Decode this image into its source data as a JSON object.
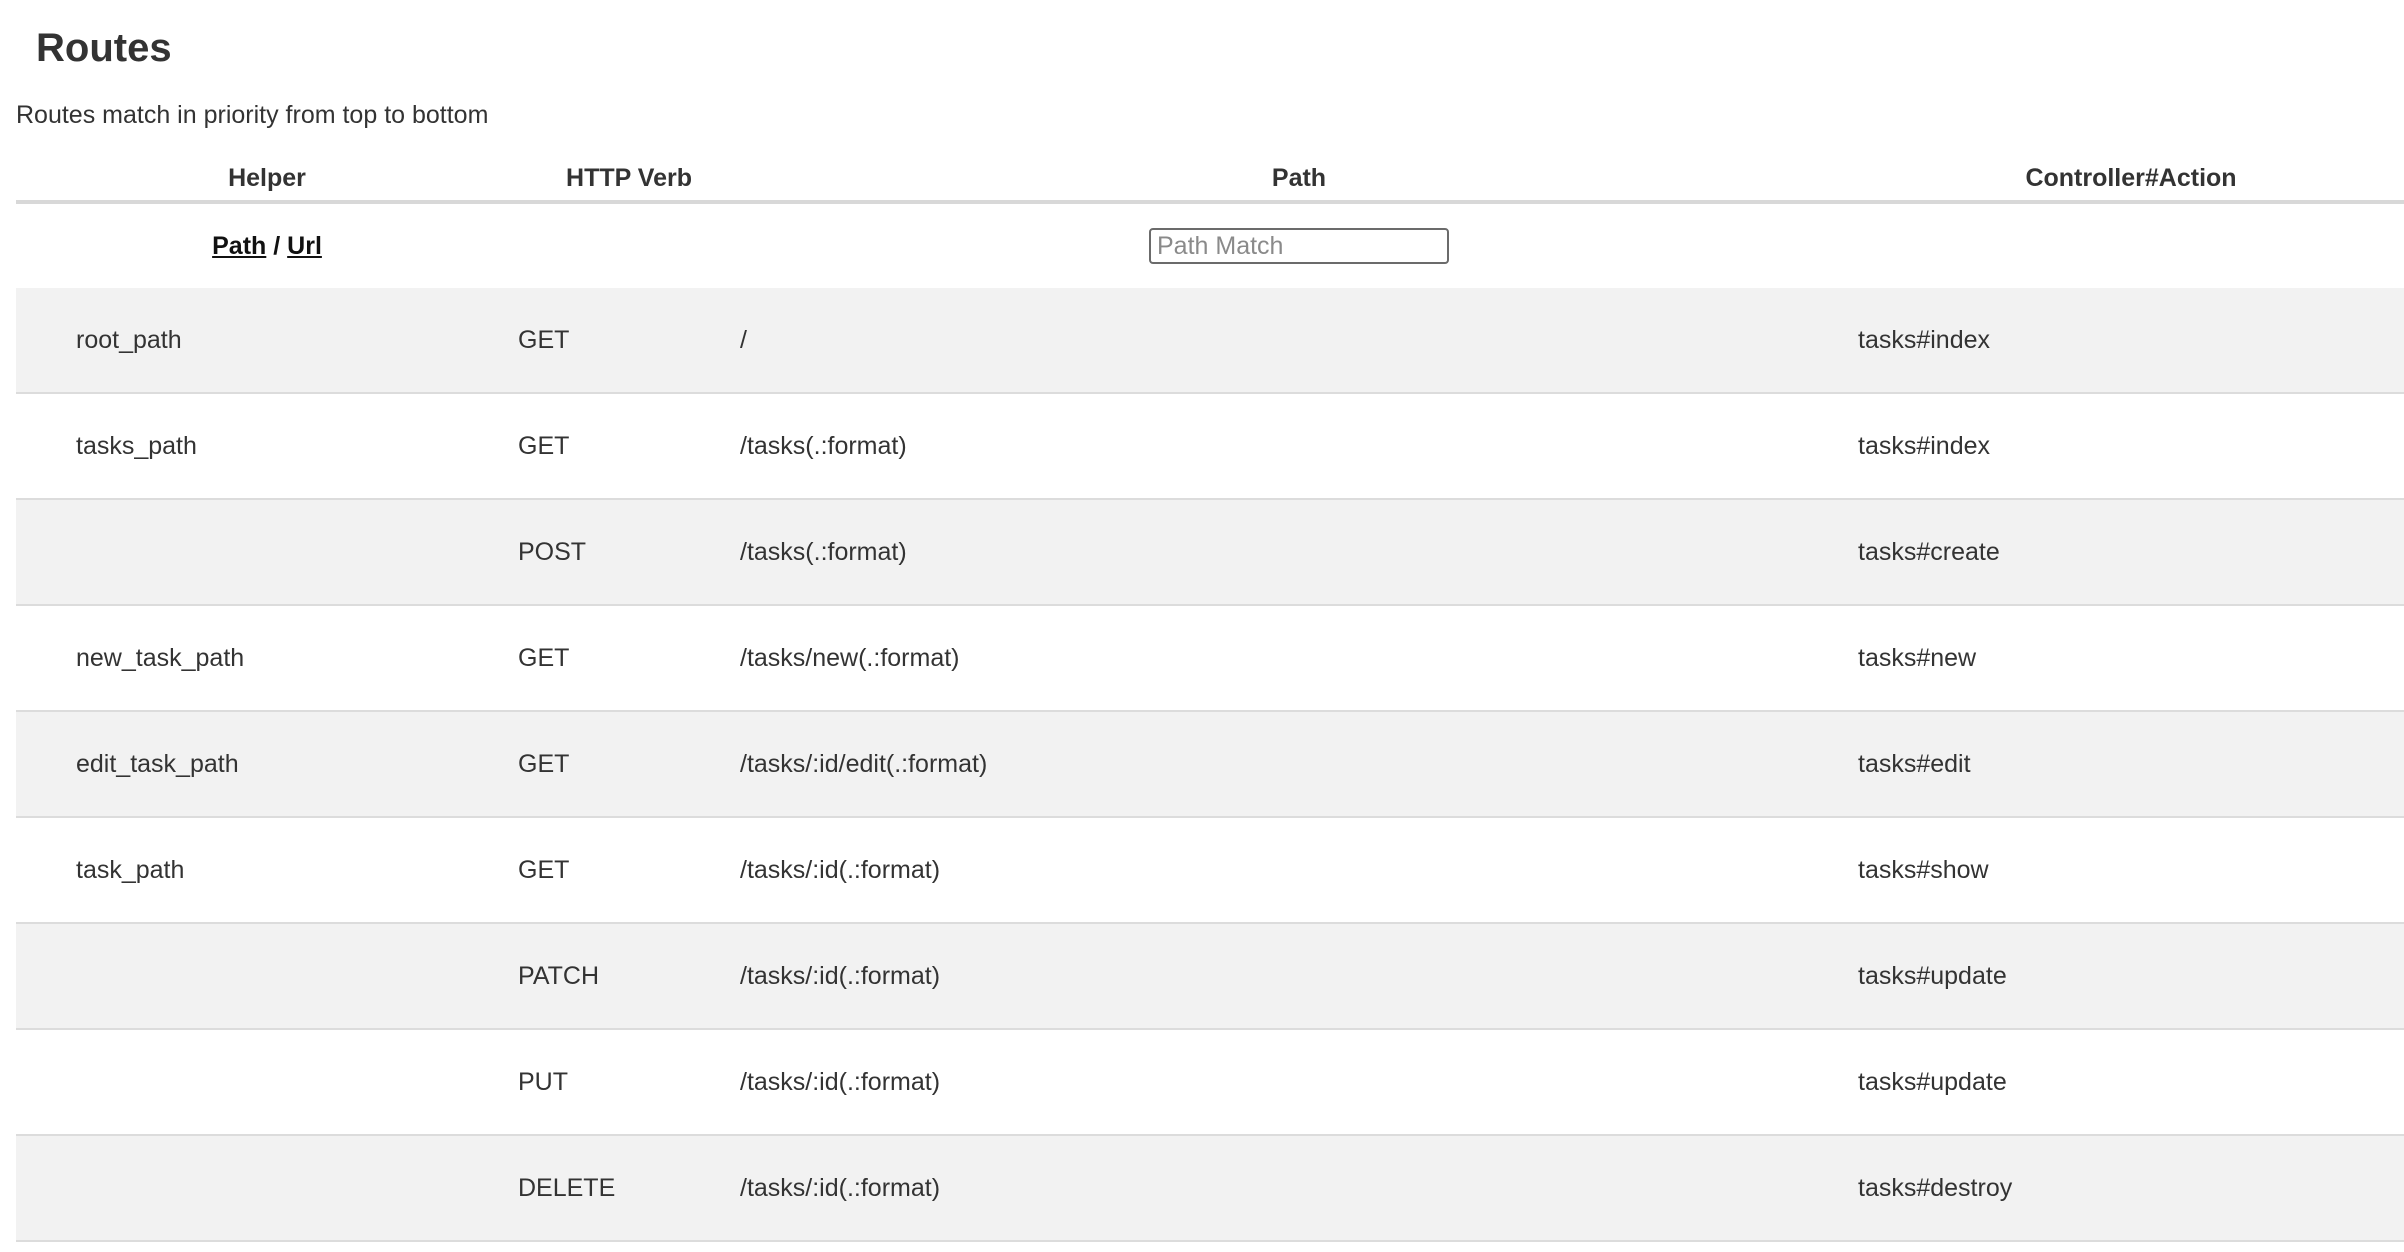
{
  "page": {
    "title": "Routes",
    "subtitle": "Routes match in priority from top to bottom"
  },
  "table": {
    "headers": {
      "helper": "Helper",
      "verb": "HTTP Verb",
      "path": "Path",
      "action": "Controller#Action"
    },
    "filter": {
      "path_link": "Path",
      "separator": "/",
      "url_link": "Url",
      "search_placeholder": "Path Match",
      "search_value": ""
    },
    "rows": [
      {
        "helper": "root_path",
        "verb": "GET",
        "path": "/",
        "action": "tasks#index"
      },
      {
        "helper": "tasks_path",
        "verb": "GET",
        "path": "/tasks(.:format)",
        "action": "tasks#index"
      },
      {
        "helper": "",
        "verb": "POST",
        "path": "/tasks(.:format)",
        "action": "tasks#create"
      },
      {
        "helper": "new_task_path",
        "verb": "GET",
        "path": "/tasks/new(.:format)",
        "action": "tasks#new"
      },
      {
        "helper": "edit_task_path",
        "verb": "GET",
        "path": "/tasks/:id/edit(.:format)",
        "action": "tasks#edit"
      },
      {
        "helper": "task_path",
        "verb": "GET",
        "path": "/tasks/:id(.:format)",
        "action": "tasks#show"
      },
      {
        "helper": "",
        "verb": "PATCH",
        "path": "/tasks/:id(.:format)",
        "action": "tasks#update"
      },
      {
        "helper": "",
        "verb": "PUT",
        "path": "/tasks/:id(.:format)",
        "action": "tasks#update"
      },
      {
        "helper": "",
        "verb": "DELETE",
        "path": "/tasks/:id(.:format)",
        "action": "tasks#destroy"
      }
    ]
  },
  "colors": {
    "text": "#333333",
    "row_shade": "#f2f2f2",
    "header_rule": "#d8d8d8",
    "row_rule": "#dcdcdc"
  }
}
